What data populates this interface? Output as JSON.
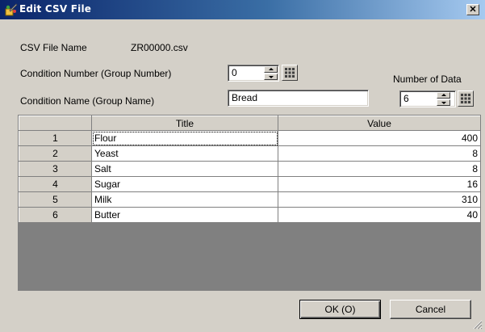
{
  "window": {
    "title": "Edit CSV File",
    "close_glyph": "✕"
  },
  "form": {
    "csv_file_name_label": "CSV File Name",
    "csv_file_name_value": "ZR00000.csv",
    "condition_number_label": "Condition Number (Group Number)",
    "condition_number_value": "0",
    "condition_name_label": "Condition Name (Group Name)",
    "condition_name_value": "Bread",
    "number_of_data_label": "Number of Data",
    "number_of_data_value": "6"
  },
  "table": {
    "columns": [
      "",
      "Title",
      "Value"
    ],
    "rows": [
      {
        "num": "1",
        "title": "Flour",
        "value": "400"
      },
      {
        "num": "2",
        "title": "Yeast",
        "value": "8"
      },
      {
        "num": "3",
        "title": "Salt",
        "value": "8"
      },
      {
        "num": "4",
        "title": "Sugar",
        "value": "16"
      },
      {
        "num": "5",
        "title": "Milk",
        "value": "310"
      },
      {
        "num": "6",
        "title": "Butter",
        "value": "40"
      }
    ]
  },
  "buttons": {
    "ok_label": "OK (O)",
    "cancel_label": "Cancel"
  },
  "colors": {
    "titlebar_start": "#0a246a",
    "titlebar_end": "#a6caf0",
    "dialog_bg": "#d4d0c8",
    "grid_empty": "#808080"
  },
  "icons": [
    "app-icon",
    "close-icon",
    "spin-up-icon",
    "spin-down-icon",
    "keypad-icon",
    "resize-grip-icon"
  ]
}
